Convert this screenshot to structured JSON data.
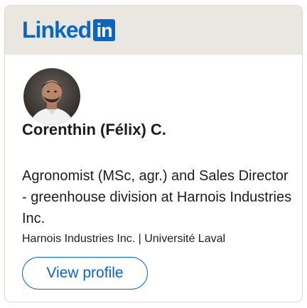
{
  "logo": {
    "text": "Linked",
    "box_text": "in",
    "brand_color": "#0a66c2"
  },
  "profile": {
    "avatar_icon": "profile-photo",
    "name": "Corenthin (Félix) C.",
    "headline": "Agronomist (MSc, agr.) and Sales Director - greenhouse division at Harnois Industries Inc.",
    "subline": "Harnois Industries Inc. | Université Laval"
  },
  "actions": {
    "view_profile_label": "View profile"
  },
  "colors": {
    "header_bg": "#eae7e1",
    "border": "#dcd9d3",
    "text": "#1c1c1c"
  }
}
